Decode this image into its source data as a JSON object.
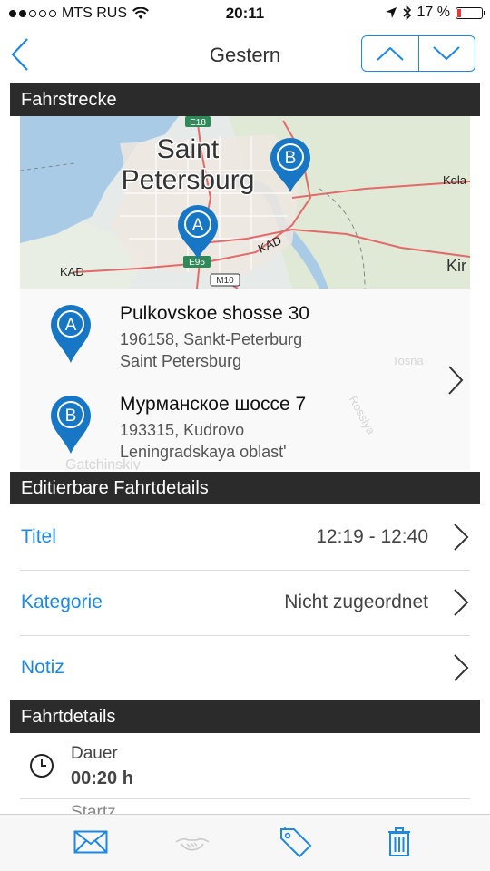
{
  "status_bar": {
    "carrier": "MTS RUS",
    "time": "20:11",
    "battery_percent": "17 %",
    "battery_level": 0.17,
    "signal_bars_filled": 2,
    "signal_bars_total": 5
  },
  "nav": {
    "title": "Gestern"
  },
  "sections": {
    "route": "Fahrstrecke",
    "editable": "Editierbare Fahrtdetails",
    "details": "Fahrtdetails"
  },
  "map": {
    "city_line1": "Saint",
    "city_line2": "Petersburg",
    "kad_left": "KAD",
    "kad_right": "KAD",
    "road_e18": "E18",
    "road_e95": "E95",
    "road_m10": "M10",
    "kola": "Kola",
    "kir": "Kir",
    "marker_a": "A",
    "marker_b": "B"
  },
  "route": {
    "start": {
      "marker": "A",
      "street": "Pulkovskoe shosse 30",
      "city": "196158, Sankt-Peterburg",
      "region": "Saint Petersburg"
    },
    "end": {
      "marker": "B",
      "street": "Мурманское шоссе 7",
      "city": "193315, Kudrovo",
      "region": "Leningradskaya oblast'"
    },
    "ghost_labels": {
      "tosna": "Tosna",
      "rossiya": "Rossiya",
      "gatchinsky": "Gatchinskiy"
    }
  },
  "editable": {
    "title": {
      "label": "Titel",
      "value": "12:19 - 12:40"
    },
    "category": {
      "label": "Kategorie",
      "value": "Nicht zugeordnet"
    },
    "note": {
      "label": "Notiz",
      "value": ""
    }
  },
  "details": {
    "duration": {
      "label": "Dauer",
      "value": "00:20 h"
    },
    "next_partial": "Startz"
  },
  "tabbar": {
    "items": [
      "envelope-icon",
      "handshake-icon",
      "tag-icon",
      "trash-icon"
    ]
  },
  "colors": {
    "accent": "#1e88e5",
    "header_bg": "#2b2b2b",
    "marker_blue": "#1777c4",
    "battery_red": "#e53935"
  }
}
